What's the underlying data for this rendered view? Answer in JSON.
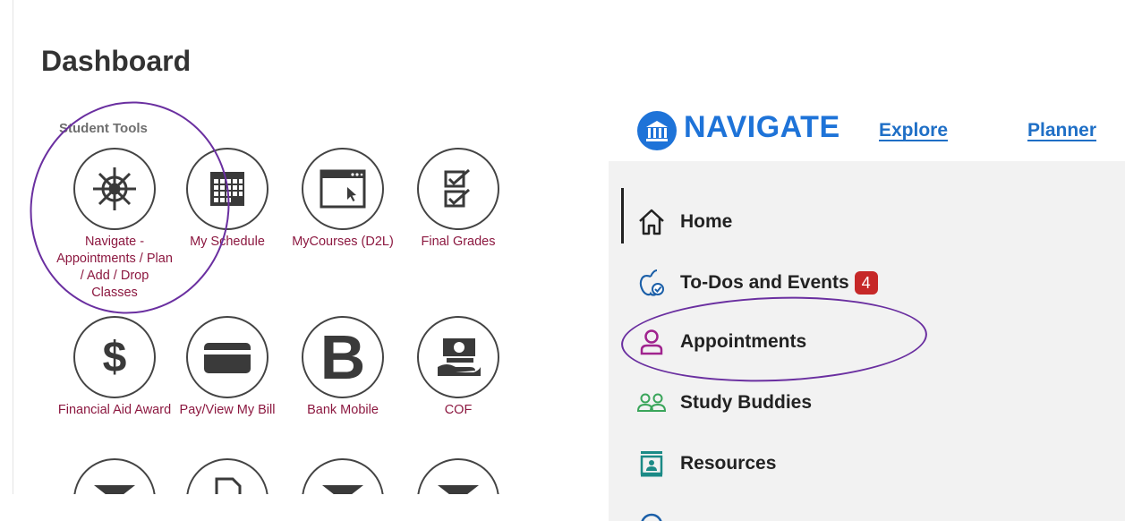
{
  "dashboard": {
    "title": "Dashboard",
    "section_heading": "Student Tools",
    "tools": [
      {
        "label": "Navigate - Appointments / Plan / Add / Drop Classes",
        "icon": "ship-wheel-icon"
      },
      {
        "label": "My Schedule",
        "icon": "calendar-grid-icon"
      },
      {
        "label": "MyCourses (D2L)",
        "icon": "browser-cursor-icon"
      },
      {
        "label": "Final Grades",
        "icon": "checklist-icon"
      },
      {
        "label": "Financial Aid Award",
        "icon": "dollar-icon"
      },
      {
        "label": "Pay/View My Bill",
        "icon": "credit-card-icon"
      },
      {
        "label": "Bank Mobile",
        "icon": "bank-mobile-b-icon"
      },
      {
        "label": "COF",
        "icon": "money-hand-icon"
      }
    ]
  },
  "navigate": {
    "logo_text": "NAVIGATE",
    "top_links": [
      "Explore",
      "Planner"
    ],
    "menu": [
      {
        "label": "Home",
        "icon": "home-icon"
      },
      {
        "label": "To-Dos and Events",
        "icon": "apple-check-icon",
        "badge": "4"
      },
      {
        "label": "Appointments",
        "icon": "person-icon"
      },
      {
        "label": "Study Buddies",
        "icon": "people-icon"
      },
      {
        "label": "Resources",
        "icon": "contact-card-icon"
      }
    ]
  },
  "colors": {
    "tool_label": "#8c1840",
    "navigate_blue": "#1e73d8",
    "annotation_ring": "#6a2fa0",
    "badge": "#c62828",
    "appointments_icon": "#a0238e",
    "study_buddies_icon": "#3aa55a",
    "resources_icon": "#1b8a86"
  }
}
